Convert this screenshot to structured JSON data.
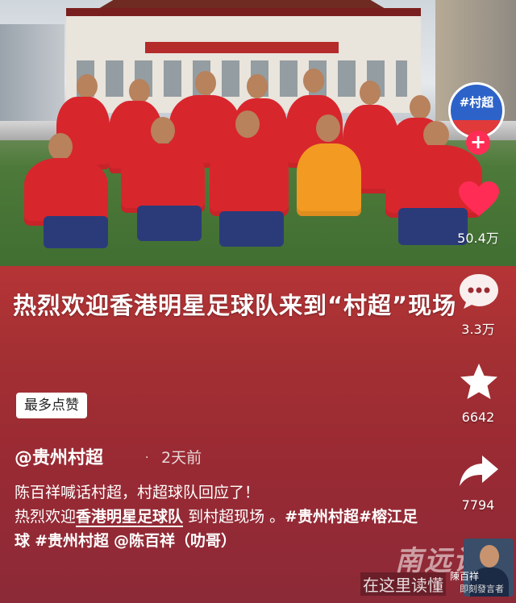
{
  "video": {
    "headline": "热烈欢迎香港明星足球队来到“村超”现场"
  },
  "actions": {
    "avatar_label": "#村超",
    "follow_glyph": "+",
    "like_count": "50.4万",
    "comment_count": "3.3万",
    "favorite_count": "6642",
    "share_count": "7794"
  },
  "info": {
    "hot_tag": "最多点赞",
    "author": "@贵州村超",
    "dot": "·",
    "time": "2天前",
    "desc_line1": "陈百祥喊话村超，村超球队回应了！",
    "desc_line2_a": "热烈欢迎",
    "desc_line2_link": "香港明星足球队",
    "desc_line2_b": " 到村超现场 。",
    "tag1": "#贵州村超",
    "tag2": "#榕江足球",
    "tag3": "#贵州村超",
    "mention": "@陈百祥（叻哥）"
  },
  "watermark": {
    "site_text": "南远论坛",
    "site_sub": "在这里读懂",
    "thumb_name": "陳百祥",
    "thumb_sub": "即刻發言者"
  },
  "colors": {
    "like": "#ff2d55",
    "accent_red": "#d8262d"
  }
}
